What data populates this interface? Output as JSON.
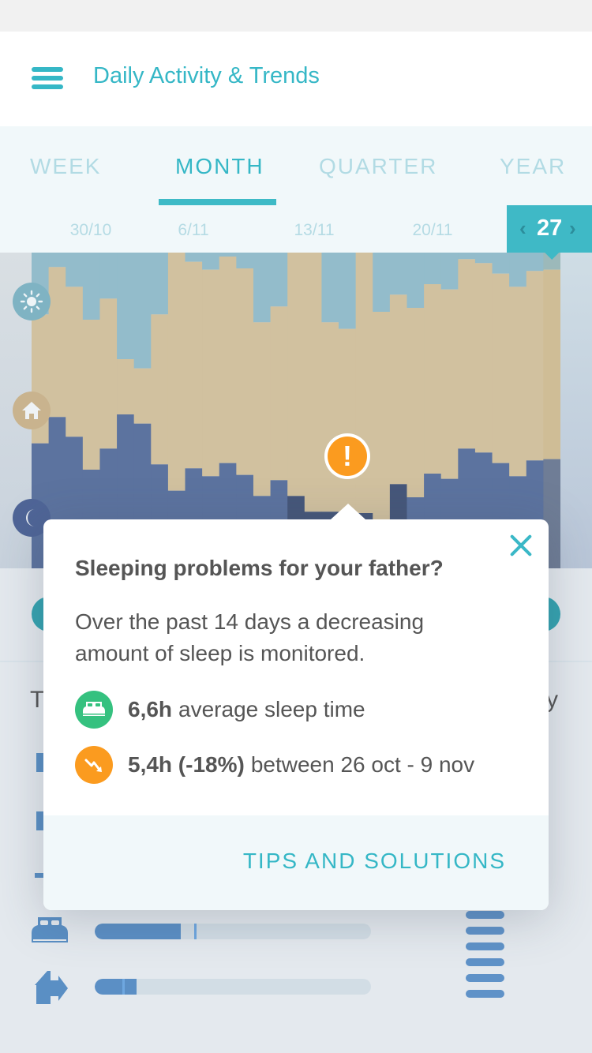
{
  "header": {
    "title": "Daily Activity & Trends",
    "menu_icon": "hamburger-menu-icon"
  },
  "tabs": [
    {
      "label": "WEEK",
      "active": false
    },
    {
      "label": "MONTH",
      "active": true
    },
    {
      "label": "QUARTER",
      "active": false
    },
    {
      "label": "YEAR",
      "active": false
    }
  ],
  "date_axis": {
    "labels": [
      "30/10",
      "6/11",
      "13/11",
      "20/11"
    ],
    "selected_day": "27",
    "prev_icon": "chevron-left-icon",
    "next_icon": "chevron-right-icon"
  },
  "legend": [
    {
      "name": "outside",
      "icon": "sun-icon",
      "color": "#93bccb"
    },
    {
      "name": "home",
      "icon": "home-icon",
      "color": "#d1c19f"
    },
    {
      "name": "sleep",
      "icon": "moon-icon",
      "color": "#5c739f"
    }
  ],
  "chart_data": {
    "type": "bar",
    "stacked": true,
    "title": "",
    "xlabel": "",
    "ylabel": "",
    "ylim": [
      0,
      24
    ],
    "unit": "hours per day",
    "x": [
      1,
      2,
      3,
      4,
      5,
      6,
      7,
      8,
      9,
      10,
      11,
      12,
      13,
      14,
      15,
      16,
      17,
      18,
      19,
      20,
      21,
      22,
      23,
      24,
      25,
      26,
      27,
      28,
      29,
      30,
      31
    ],
    "x_tick_labels": [
      "30/10",
      "6/11",
      "13/11",
      "20/11",
      "27"
    ],
    "selected_index": 30,
    "highlighted_range": [
      15,
      21
    ],
    "series": [
      {
        "name": "sleep",
        "color": "#5c739f",
        "highlight_color": "#46577a",
        "values": [
          9.5,
          11.5,
          10.0,
          7.5,
          9.1,
          11.7,
          11.0,
          7.9,
          5.9,
          7.6,
          7.0,
          8.0,
          7.1,
          5.5,
          6.7,
          5.5,
          4.3,
          4.3,
          4.2,
          4.2,
          3.5,
          6.4,
          5.4,
          7.2,
          6.8,
          9.1,
          8.8,
          8.0,
          7.0,
          8.2,
          8.3
        ]
      },
      {
        "name": "home",
        "color": "#d1c19f",
        "values": [
          9.8,
          11.4,
          11.4,
          11.4,
          11.4,
          4.2,
          4.2,
          11.4,
          18.1,
          15.7,
          15.7,
          15.7,
          15.7,
          13.2,
          13.2,
          18.5,
          19.7,
          14.4,
          14.0,
          19.8,
          16.0,
          14.4,
          14.4,
          14.4,
          14.4,
          14.4,
          14.4,
          14.4,
          14.4,
          14.4,
          14.4
        ]
      },
      {
        "name": "outside",
        "color": "#93bccb",
        "values": [
          4.7,
          1.1,
          2.6,
          5.1,
          3.5,
          8.1,
          8.8,
          4.7,
          0.0,
          0.7,
          1.4,
          0.3,
          1.3,
          5.3,
          4.1,
          0.0,
          0.0,
          5.3,
          5.8,
          0.0,
          4.5,
          3.2,
          4.2,
          2.4,
          2.8,
          0.5,
          0.8,
          1.6,
          2.6,
          1.4,
          1.3
        ]
      }
    ],
    "annotations": [
      {
        "type": "alert",
        "icon": "exclamation-icon",
        "color": "#fb9b1f"
      }
    ],
    "grid": false,
    "legend_position": "left"
  },
  "popup": {
    "title": "Sleeping problems for your father?",
    "body": "Over the past 14 days a decreasing amount of sleep is monitored.",
    "stats": [
      {
        "icon": "bed-icon",
        "value": "6,6h",
        "text": "average sleep time",
        "color": "#35c17f"
      },
      {
        "icon": "trend-down-icon",
        "value": "5,4h (-18%)",
        "text": "between 26 oct - 9 nov",
        "color": "#fb9b1f"
      }
    ],
    "action_label": "TIPS AND SOLUTIONS",
    "close_icon": "close-icon"
  },
  "background": {
    "text_fragment_left": "T",
    "text_fragment_right": "y",
    "activity_bars": [
      {
        "icon": "bed-icon",
        "fill": 0.31,
        "marker": 0.36
      },
      {
        "icon": "leave-home-icon",
        "fill": 0.15,
        "marker": 0.1
      }
    ]
  }
}
